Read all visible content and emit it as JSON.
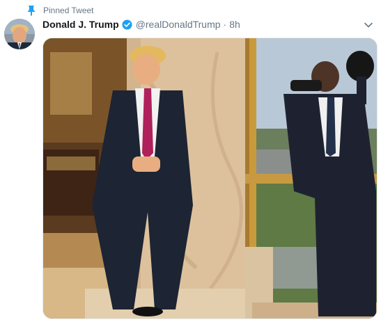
{
  "pinned": {
    "label": "Pinned Tweet",
    "icon": "pin-icon"
  },
  "tweet": {
    "author": {
      "display_name": "Donald J. Trump",
      "verified": true,
      "handle": "@realDonaldTrump",
      "separator": "·",
      "time": "8h"
    },
    "media": {
      "type": "photo"
    }
  },
  "colors": {
    "accent": "#1da1f2",
    "text_primary": "#14171a",
    "text_secondary": "#657786"
  }
}
